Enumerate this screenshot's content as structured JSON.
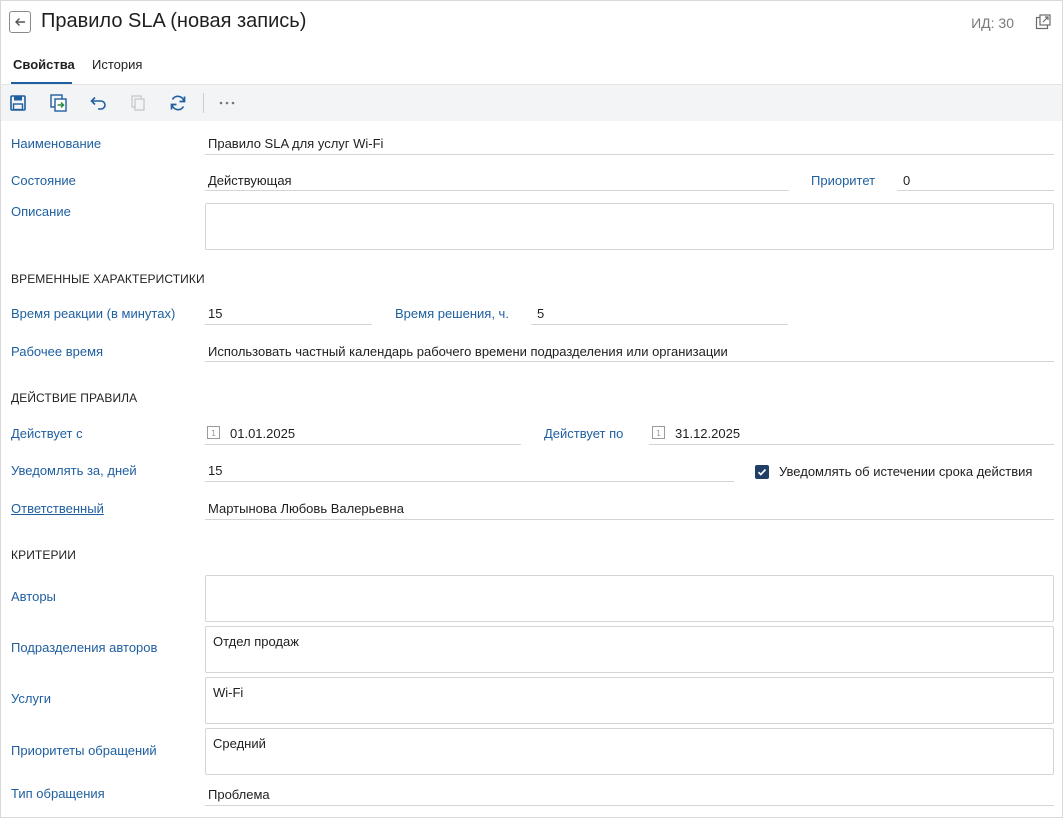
{
  "header": {
    "title": "Правило SLA (новая запись)",
    "id_label": "ИД: 30"
  },
  "tabs": [
    {
      "label": "Свойства",
      "active": true
    },
    {
      "label": "История",
      "active": false
    }
  ],
  "toolbar": {
    "icons": [
      "save-icon",
      "save-and-close-icon",
      "undo-icon",
      "copy-icon",
      "refresh-icon",
      "more-icon"
    ]
  },
  "form": {
    "name": {
      "label": "Наименование",
      "value": "Правило SLA для услуг Wi-Fi"
    },
    "state": {
      "label": "Состояние",
      "value": "Действующая"
    },
    "priority": {
      "label": "Приоритет",
      "value": "0"
    },
    "description": {
      "label": "Описание",
      "value": ""
    },
    "time_section": "ВРЕМЕННЫЕ ХАРАКТЕРИСТИКИ",
    "reaction_time": {
      "label": "Время реакции (в минутах)",
      "value": "15"
    },
    "resolve_time": {
      "label": "Время решения, ч.",
      "value": "5"
    },
    "work_time": {
      "label": "Рабочее время",
      "value": "Использовать частный календарь рабочего времени подразделения или организации"
    },
    "action_section": "ДЕЙСТВИЕ ПРАВИЛА",
    "valid_from": {
      "label": "Действует с",
      "value": "01.01.2025"
    },
    "valid_to": {
      "label": "Действует по",
      "value": "31.12.2025"
    },
    "notify_days": {
      "label": "Уведомлять за, дней",
      "value": "15"
    },
    "notify_expire": {
      "label": "Уведомлять об истечении срока действия",
      "checked": true
    },
    "responsible": {
      "label": "Ответственный",
      "value": "Мартынова Любовь Валерьевна"
    },
    "criteria_section": "КРИТЕРИИ",
    "authors": {
      "label": "Авторы",
      "value": ""
    },
    "author_departments": {
      "label": "Подразделения авторов",
      "value": "Отдел продаж"
    },
    "services": {
      "label": "Услуги",
      "value": "Wi-Fi"
    },
    "request_priorities": {
      "label": "Приоритеты обращений",
      "value": "Средний"
    },
    "request_type": {
      "label": "Тип обращения",
      "value": "Проблема"
    }
  },
  "colors": {
    "label_blue": "#1f5fa0",
    "checkbox": "#1f3f66",
    "toolbar_bg": "#f3f4f6"
  }
}
